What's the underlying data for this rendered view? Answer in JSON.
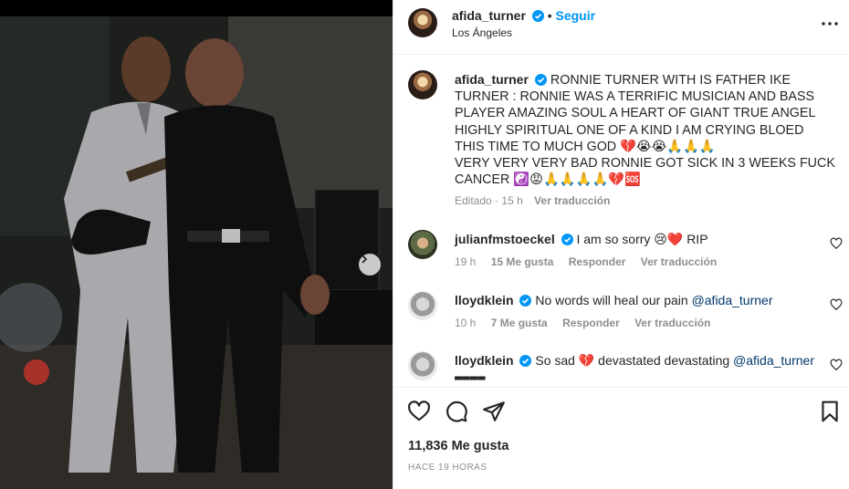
{
  "post": {
    "author": "afida_turner",
    "follow_label": "Seguir",
    "location": "Los Ángeles",
    "caption_line1": "RONNIE TURNER WITH IS FATHER IKE TURNER : RONNIE WAS A TERRIFIC MUSICIAN AND BASS PLAYER AMAZING SOUL A HEART OF GIANT TRUE ANGEL HIGHLY SPIRITUAL ONE OF A KIND I AM CRYING BLOED THIS TIME TO MUCH GOD 💔😭😭🙏🙏🙏",
    "caption_line2": "VERY VERY VERY BAD RONNIE GOT SICK IN 3 WEEKS FUCK CANCER ☯️😡🙏🙏🙏🙏💔🆘",
    "edited_label": "Editado",
    "edited_time": "15 h",
    "translate_label": "Ver traducción"
  },
  "comments": [
    {
      "user": "julianfmstoeckel",
      "text": "I am so sorry 😢❤️ RIP",
      "time": "19 h",
      "likes": "15 Me gusta",
      "reply": "Responder",
      "translate": "Ver traducción"
    },
    {
      "user": "lloydklein",
      "text": "No words will heal our pain ",
      "mention": "@afida_turner",
      "time": "10 h",
      "likes": "7 Me gusta",
      "reply": "Responder",
      "translate": "Ver traducción"
    },
    {
      "user": "lloydklein",
      "text": "So sad 💔 devastated devastating ",
      "mention": "@afida_turner",
      "extra": "▬▬▬▬"
    }
  ],
  "footer": {
    "likes": "11,836 Me gusta",
    "time_ago": "HACE 19 HORAS"
  },
  "icons": {
    "verified": "verified-badge-icon",
    "more": "more-options-icon",
    "like": "heart-icon",
    "comment": "comment-icon",
    "share": "share-icon",
    "save": "bookmark-icon",
    "next": "chevron-right-icon"
  },
  "colors": {
    "accent": "#0095f6",
    "verified": "#0095f6",
    "muted": "#8e8e8e",
    "text": "#262626"
  }
}
